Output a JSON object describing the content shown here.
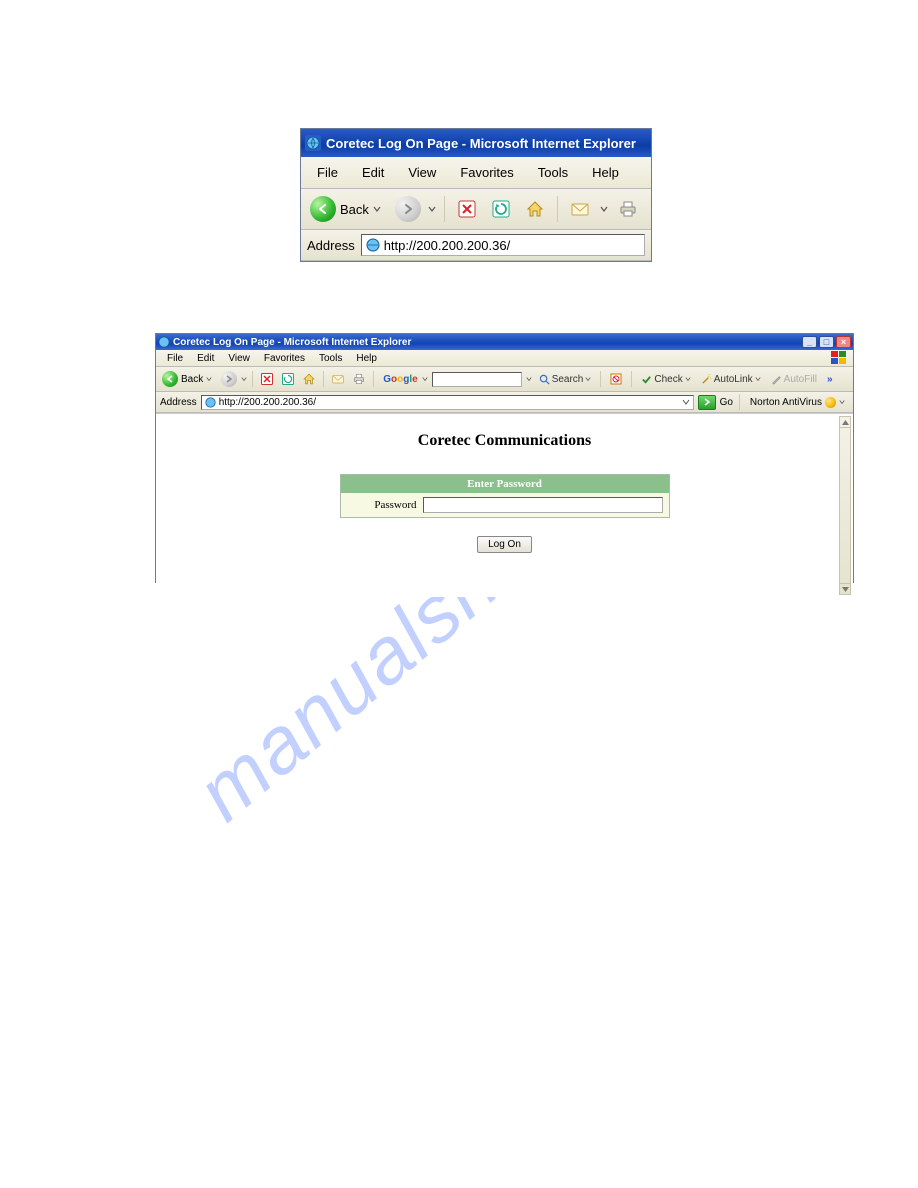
{
  "watermark": "manualshive.com",
  "shot1": {
    "title": "Coretec Log On Page - Microsoft Internet Explorer",
    "menu": [
      "File",
      "Edit",
      "View",
      "Favorites",
      "Tools",
      "Help"
    ],
    "back_label": "Back",
    "address_label": "Address",
    "url": "http://200.200.200.36/"
  },
  "shot2": {
    "title": "Coretec Log On Page - Microsoft Internet Explorer",
    "menu": [
      "File",
      "Edit",
      "View",
      "Favorites",
      "Tools",
      "Help"
    ],
    "back_label": "Back",
    "google_label": "Google",
    "search_label": "Search",
    "check_label": "Check",
    "autolink_label": "AutoLink",
    "autofill_label": "AutoFill",
    "address_label": "Address",
    "url": "http://200.200.200.36/",
    "go_label": "Go",
    "norton_label": "Norton AntiVirus",
    "page": {
      "heading": "Coretec Communications",
      "form_header": "Enter Password",
      "password_label": "Password",
      "logon_label": "Log On"
    }
  }
}
